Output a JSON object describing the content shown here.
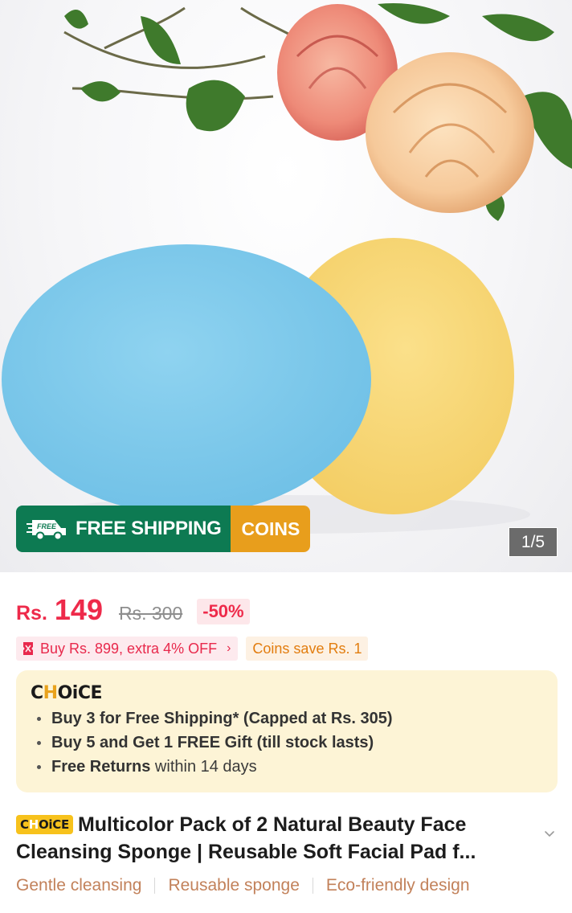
{
  "gallery": {
    "banner_shipping_label": "FREE SHIPPING",
    "banner_truck_text": "FREE",
    "banner_coins_label": "COINS",
    "image_counter": "1/5"
  },
  "price": {
    "currency": "Rs.",
    "current": "149",
    "original": "Rs. 300",
    "discount": "-50%"
  },
  "promos": {
    "bundle_offer": "Buy Rs. 899, extra 4% OFF",
    "coins_offer": "Coins save Rs. 1"
  },
  "choice_card": {
    "logo": {
      "pre": "C",
      "dot": "H",
      "post": "OiCE"
    },
    "items": [
      {
        "bold": "Buy 3 for  Free Shipping* (Capped at Rs. 305)",
        "rest": ""
      },
      {
        "bold": "Buy 5 and Get 1 FREE Gift (till stock lasts)",
        "rest": ""
      },
      {
        "bold": "Free Returns",
        "rest": " within 14 days"
      }
    ]
  },
  "product": {
    "badge": {
      "pre": "C",
      "dot": "H",
      "post": "OiCE"
    },
    "title_line1": "Multicolor Pack of 2 Natural Beauty Face",
    "title_line2": "Cleansing Sponge | Reusable Soft Facial Pad f..."
  },
  "tags": [
    "Gentle cleansing",
    "Reusable sponge",
    "Eco-friendly design"
  ],
  "colors": {
    "price_red": "#ee2a4a",
    "shipping_green": "#0d7a52",
    "coins_orange": "#e89e1c",
    "choice_bg": "#fdf4d6",
    "choice_badge_yellow": "#f7c21c",
    "tag_text": "#c2815a"
  },
  "icons": [
    "truck-icon",
    "ticket-icon",
    "chevron-right-icon",
    "chevron-down-icon"
  ]
}
